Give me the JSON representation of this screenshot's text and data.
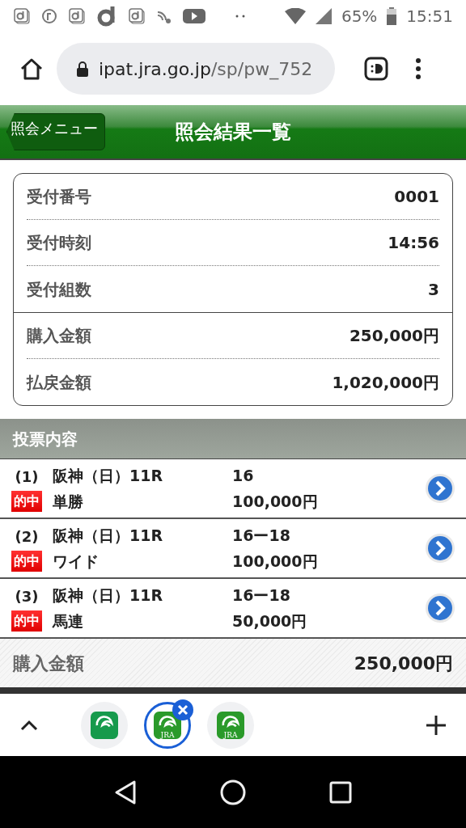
{
  "status_bar": {
    "battery": "65%",
    "time": "15:51"
  },
  "browser": {
    "url_host": "ipat.jra.go.jp",
    "url_path": "/sp/pw_752"
  },
  "header": {
    "back_button": "照会メニュー",
    "title": "照会結果一覧"
  },
  "receipt": {
    "reception": [
      {
        "label": "受付番号",
        "value": "0001"
      },
      {
        "label": "受付時刻",
        "value": "14:56"
      },
      {
        "label": "受付組数",
        "value": "3"
      }
    ],
    "amounts": [
      {
        "label": "購入金額",
        "value": "250,000円"
      },
      {
        "label": "払戻金額",
        "value": "1,020,000円"
      }
    ]
  },
  "section_title": "投票内容",
  "bets": [
    {
      "number": "(1)",
      "race": "阪神（日）11R",
      "badge": "的中",
      "hit": true,
      "type": "単勝",
      "horses": "16",
      "amount": "100,000円"
    },
    {
      "number": "(2)",
      "race": "阪神（日）11R",
      "badge": "的中",
      "hit": true,
      "type": "ワイド",
      "horses": "16ー18",
      "amount": "100,000円"
    },
    {
      "number": "(3)",
      "race": "阪神（日）11R",
      "badge": "的中",
      "hit": true,
      "type": "馬連",
      "horses": "16ー18",
      "amount": "50,000円"
    }
  ],
  "total": {
    "label": "購入金額",
    "value": "250,000円"
  },
  "tabs": [
    {
      "selected": false
    },
    {
      "logo_text": "JRA",
      "selected": true
    },
    {
      "logo_text": "JRA",
      "selected": false
    }
  ]
}
